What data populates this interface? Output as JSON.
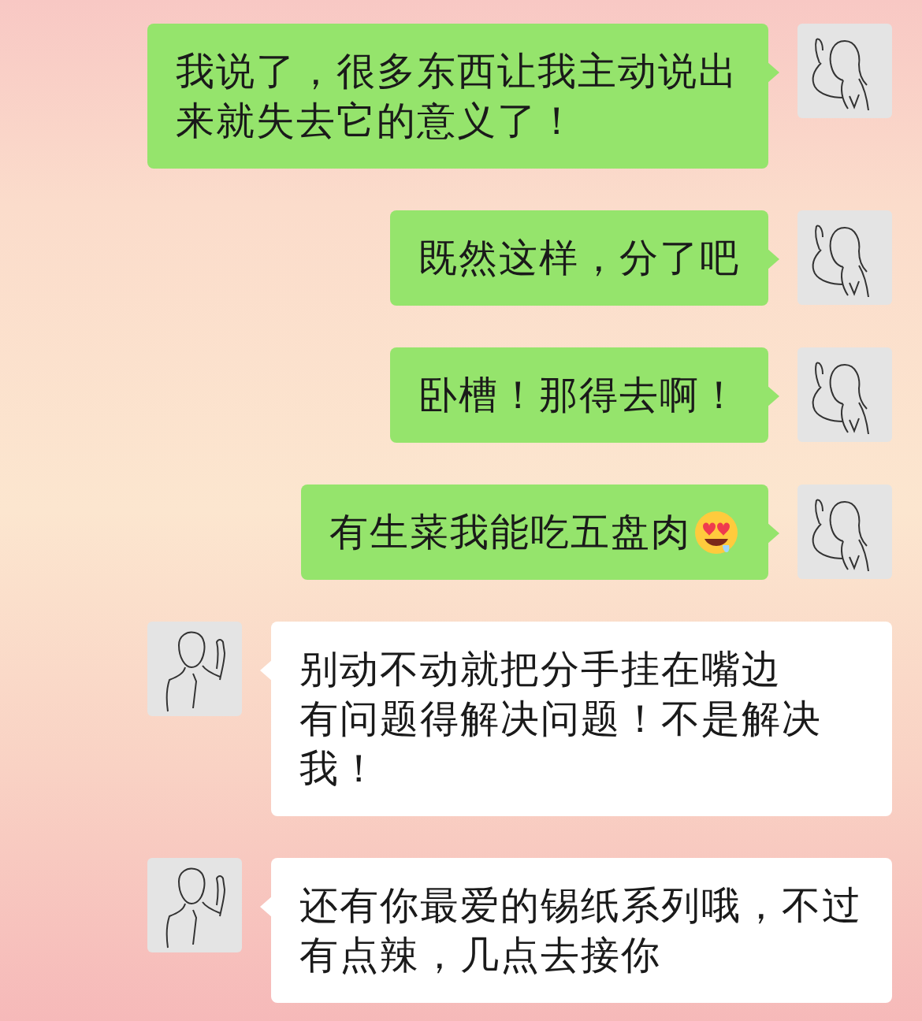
{
  "messages": [
    {
      "kind": "sent",
      "lines": [
        "我说了，很多东西让我主动说出来就失去它的意义了！"
      ]
    },
    {
      "kind": "sent",
      "lines": [
        "既然这样，分了吧"
      ]
    },
    {
      "kind": "sent",
      "lines": [
        "卧槽！那得去啊！"
      ]
    },
    {
      "kind": "sent",
      "lines": [
        "有生菜我能吃五盘肉"
      ],
      "emoji": true
    },
    {
      "kind": "received",
      "lines": [
        "别动不动就把分手挂在嘴边",
        "有问题得解决问题！不是解决我！"
      ]
    },
    {
      "kind": "received",
      "lines": [
        "还有你最爱的锡纸系列哦，不过有点辣，几点去接你"
      ]
    }
  ]
}
